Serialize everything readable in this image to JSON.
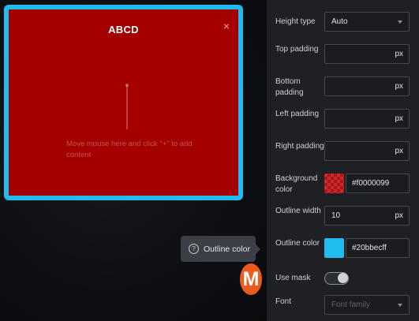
{
  "popup": {
    "title": "ABCD",
    "close_glyph": "×",
    "hint": "Move mouse here and click \"+\" to add content",
    "background_color": "#a50000",
    "outline_color": "#20bbef"
  },
  "tooltip": {
    "icon": "question-circle-icon",
    "icon_glyph": "?",
    "text": "Outline color"
  },
  "badge": {
    "letter": "M",
    "color": "#ea5b1c"
  },
  "panel": {
    "height_type": {
      "label": "Height type",
      "value": "Auto"
    },
    "top_padding": {
      "label": "Top padding",
      "value": "",
      "unit": "px"
    },
    "bottom_padding": {
      "label": "Bottom padding",
      "value": "",
      "unit": "px"
    },
    "left_padding": {
      "label": "Left padding",
      "value": "",
      "unit": "px"
    },
    "right_padding": {
      "label": "Right padding",
      "value": "",
      "unit": "px"
    },
    "background_color": {
      "label": "Background color",
      "value": "#f0000099"
    },
    "outline_width": {
      "label": "Outline width",
      "value": "10",
      "unit": "px"
    },
    "outline_color": {
      "label": "Outline color",
      "value": "#20bbecff"
    },
    "use_mask": {
      "label": "Use mask",
      "on": true
    },
    "font": {
      "label": "Font",
      "placeholder": "Font family"
    }
  }
}
